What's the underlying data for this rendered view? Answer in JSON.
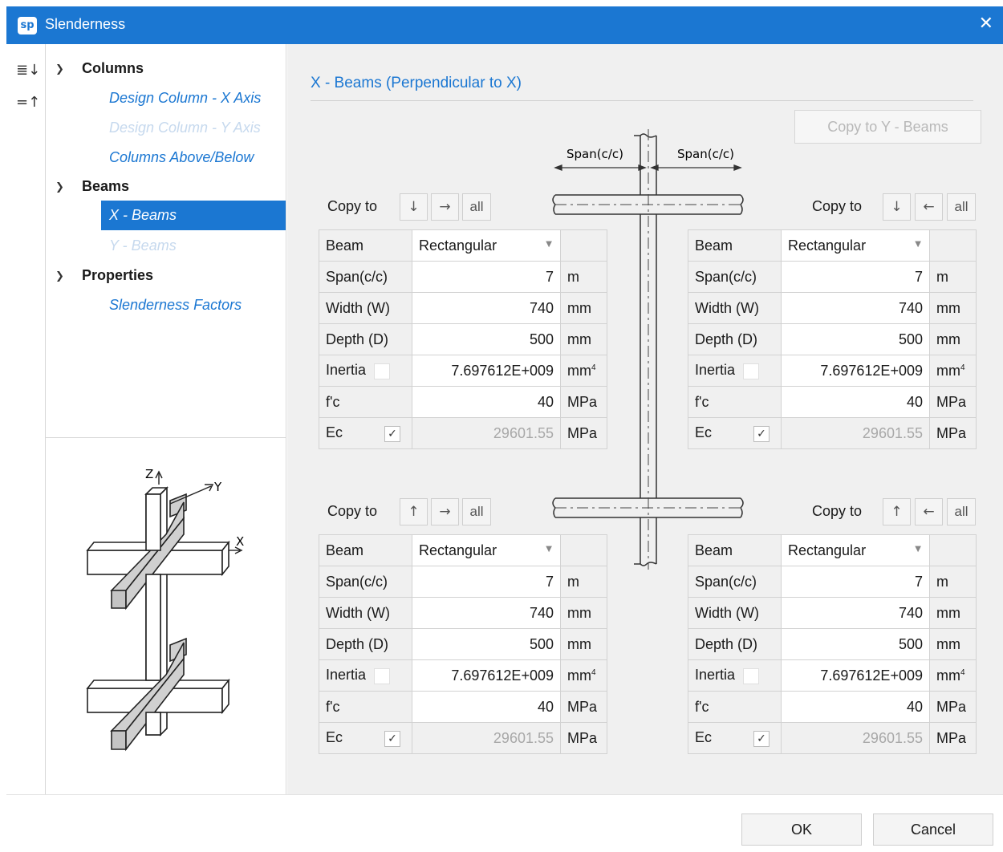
{
  "window": {
    "title": "Slenderness",
    "logo": "sp",
    "close_icon": "close-icon"
  },
  "toolbar": {
    "expand_icon": "expand-all-icon",
    "collapse_icon": "collapse-all-icon"
  },
  "tree": {
    "columns": {
      "label": "Columns",
      "items": [
        "Design Column - X Axis",
        "Design Column - Y Axis",
        "Columns Above/Below"
      ]
    },
    "beams": {
      "label": "Beams",
      "items": [
        "X - Beams",
        "Y - Beams"
      ]
    },
    "properties": {
      "label": "Properties",
      "items": [
        "Slenderness Factors"
      ]
    }
  },
  "preview": {
    "z_label": "Z",
    "y_label": "Y",
    "x_label": "X"
  },
  "section": {
    "title": "X - Beams (Perpendicular to X)",
    "copy_y_button": "Copy to Y - Beams"
  },
  "diagram": {
    "span_left": "Span(c/c)",
    "span_right": "Span(c/c)"
  },
  "copy_to_label": "Copy to",
  "all_label": "all",
  "panels": [
    {
      "copy_arrows": [
        "↓",
        "→"
      ],
      "beam_label": "Beam",
      "beam_type": "Rectangular",
      "span": {
        "label": "Span(c/c)",
        "value": "7",
        "unit": "m"
      },
      "width": {
        "label": "Width (W)",
        "value": "740",
        "unit": "mm"
      },
      "depth": {
        "label": "Depth (D)",
        "value": "500",
        "unit": "mm"
      },
      "inertia": {
        "label": "Inertia",
        "value": "7.697612E+009",
        "unit": "mm",
        "checked": false
      },
      "fc": {
        "label": "f'c",
        "value": "40",
        "unit": "MPa"
      },
      "ec": {
        "label": "Ec",
        "value": "29601.55",
        "unit": "MPa",
        "checked": true
      }
    },
    {
      "copy_arrows": [
        "↓",
        "←"
      ],
      "beam_label": "Beam",
      "beam_type": "Rectangular",
      "span": {
        "label": "Span(c/c)",
        "value": "7",
        "unit": "m"
      },
      "width": {
        "label": "Width (W)",
        "value": "740",
        "unit": "mm"
      },
      "depth": {
        "label": "Depth (D)",
        "value": "500",
        "unit": "mm"
      },
      "inertia": {
        "label": "Inertia",
        "value": "7.697612E+009",
        "unit": "mm",
        "checked": false
      },
      "fc": {
        "label": "f'c",
        "value": "40",
        "unit": "MPa"
      },
      "ec": {
        "label": "Ec",
        "value": "29601.55",
        "unit": "MPa",
        "checked": true
      }
    },
    {
      "copy_arrows": [
        "↑",
        "→"
      ],
      "beam_label": "Beam",
      "beam_type": "Rectangular",
      "span": {
        "label": "Span(c/c)",
        "value": "7",
        "unit": "m"
      },
      "width": {
        "label": "Width (W)",
        "value": "740",
        "unit": "mm"
      },
      "depth": {
        "label": "Depth (D)",
        "value": "500",
        "unit": "mm"
      },
      "inertia": {
        "label": "Inertia",
        "value": "7.697612E+009",
        "unit": "mm",
        "checked": false
      },
      "fc": {
        "label": "f'c",
        "value": "40",
        "unit": "MPa"
      },
      "ec": {
        "label": "Ec",
        "value": "29601.55",
        "unit": "MPa",
        "checked": true
      }
    },
    {
      "copy_arrows": [
        "↑",
        "←"
      ],
      "beam_label": "Beam",
      "beam_type": "Rectangular",
      "span": {
        "label": "Span(c/c)",
        "value": "7",
        "unit": "m"
      },
      "width": {
        "label": "Width (W)",
        "value": "740",
        "unit": "mm"
      },
      "depth": {
        "label": "Depth (D)",
        "value": "500",
        "unit": "mm"
      },
      "inertia": {
        "label": "Inertia",
        "value": "7.697612E+009",
        "unit": "mm",
        "checked": false
      },
      "fc": {
        "label": "f'c",
        "value": "40",
        "unit": "MPa"
      },
      "ec": {
        "label": "Ec",
        "value": "29601.55",
        "unit": "MPa",
        "checked": true
      }
    }
  ],
  "footer": {
    "ok": "OK",
    "cancel": "Cancel"
  }
}
